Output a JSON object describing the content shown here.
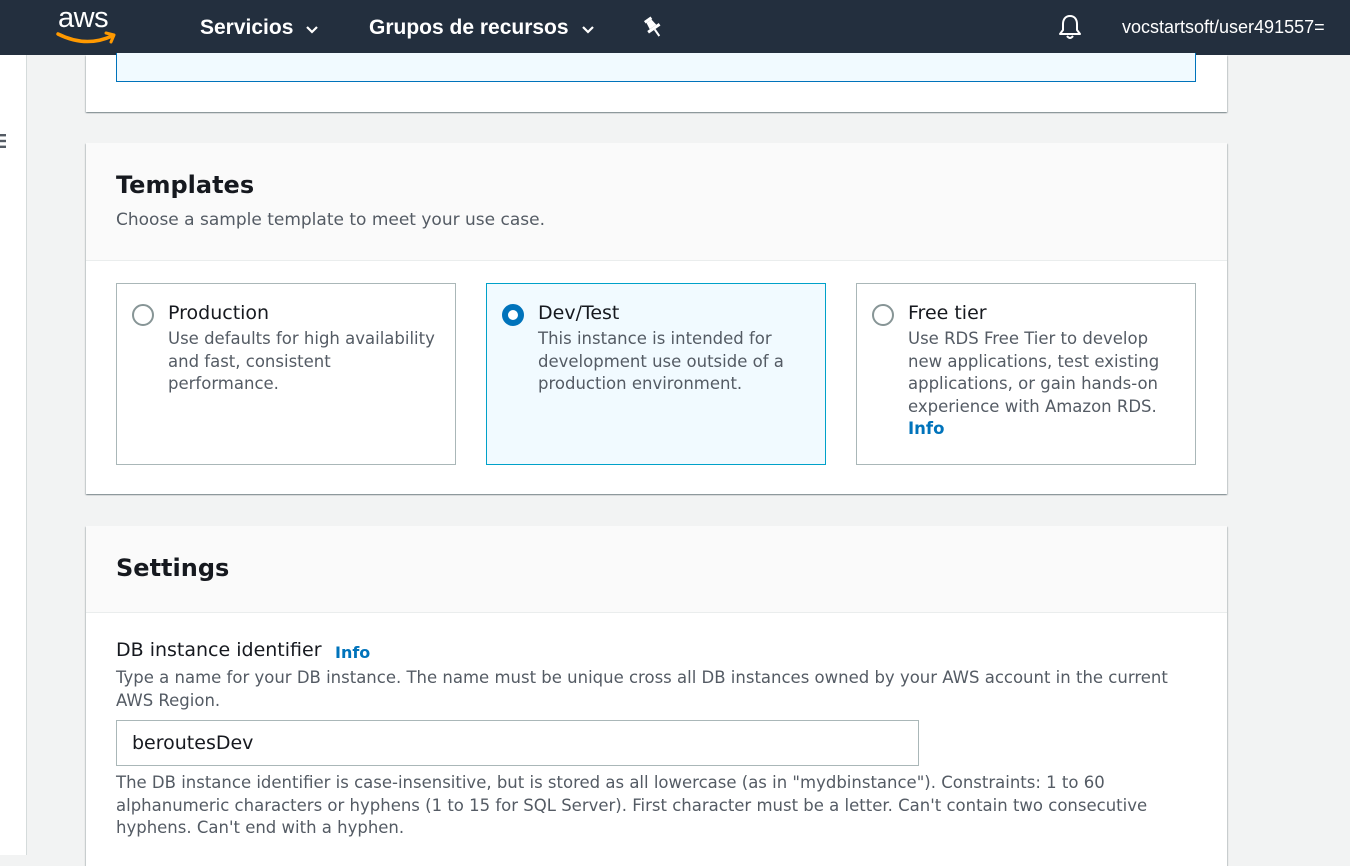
{
  "topnav": {
    "logo_text": "aws",
    "services_label": "Servicios",
    "resource_groups_label": "Grupos de recursos",
    "account_label": "vocstartsoft/user491557="
  },
  "templates": {
    "title": "Templates",
    "description": "Choose a sample template to meet your use case.",
    "options": [
      {
        "label": "Production",
        "description": "Use defaults for high availability and fast, consistent performance.",
        "selected": false
      },
      {
        "label": "Dev/Test",
        "description": "This instance is intended for development use outside of a production environment.",
        "selected": true
      },
      {
        "label": "Free tier",
        "description": "Use RDS Free Tier to develop new applications, test existing applications, or gain hands-on experience with Amazon RDS.",
        "info_label": "Info",
        "selected": false
      }
    ]
  },
  "settings": {
    "title": "Settings",
    "db_identifier": {
      "label": "DB instance identifier",
      "info_label": "Info",
      "description": "Type a name for your DB instance. The name must be unique cross all DB instances owned by your AWS account in the current AWS Region.",
      "value": "beroutesDev",
      "constraint": "The DB instance identifier is case-insensitive, but is stored as all lowercase (as in \"mydbinstance\"). Constraints: 1 to 60 alphanumeric characters or hyphens (1 to 15 for SQL Server). First character must be a letter. Can't contain two consecutive hyphens. Can't end with a hyphen."
    }
  },
  "colors": {
    "nav_background": "#232f3e",
    "accent_blue": "#0073bb",
    "selected_tile_background": "#f1faff",
    "selected_tile_border": "#00a1c9",
    "logo_smile": "#ff9900"
  },
  "icons": {
    "logo": "aws-logo-icon",
    "services_caret": "chevron-down-icon",
    "groups_caret": "chevron-down-icon",
    "pin": "pin-icon",
    "notifications": "bell-icon",
    "sidebar_toggle": "hamburger-menu-icon"
  }
}
